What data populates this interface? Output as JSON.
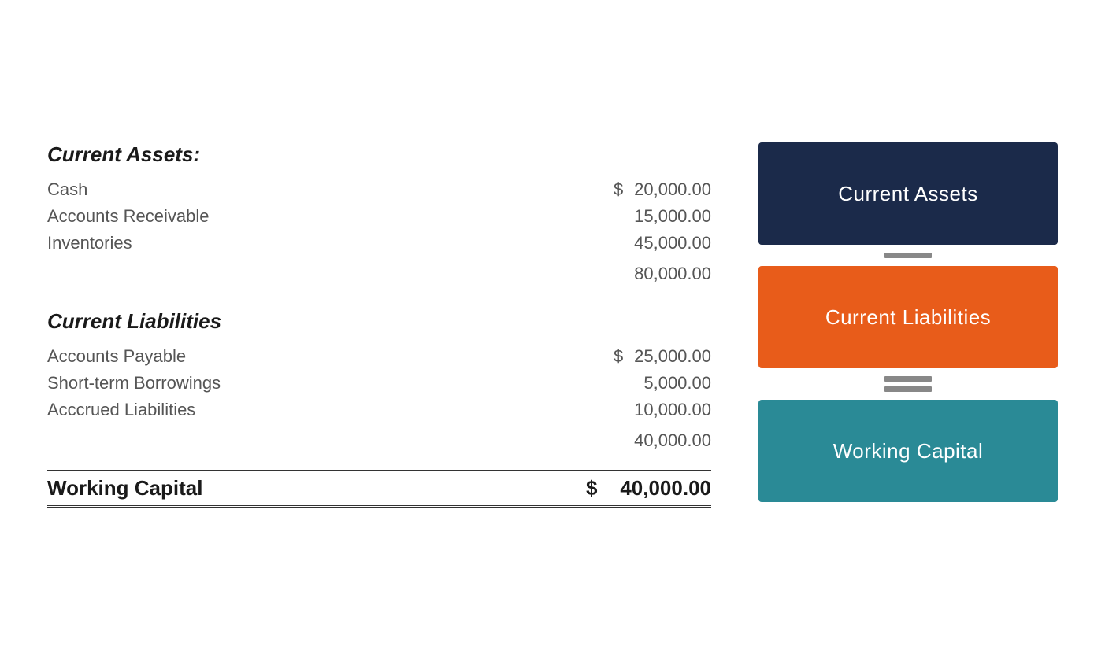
{
  "current_assets": {
    "header": "Current Assets:",
    "items": [
      {
        "label": "Cash",
        "dollar": "$",
        "amount": "20,000.00"
      },
      {
        "label": "Accounts Receivable",
        "dollar": "",
        "amount": "15,000.00"
      },
      {
        "label": "Inventories",
        "dollar": "",
        "amount": "45,000.00"
      }
    ],
    "subtotal": "80,000.00"
  },
  "current_liabilities": {
    "header": "Current Liabilities",
    "items": [
      {
        "label": "Accounts Payable",
        "dollar": "$",
        "amount": "25,000.00"
      },
      {
        "label": "Short-term Borrowings",
        "dollar": "",
        "amount": "5,000.00"
      },
      {
        "label": "Acccrued Liabilities",
        "dollar": "",
        "amount": "10,000.00"
      }
    ],
    "subtotal": "40,000.00"
  },
  "working_capital": {
    "label": "Working Capital",
    "dollar": "$",
    "amount": "40,000.00"
  },
  "right_panel": {
    "card_current_assets": "Current Assets",
    "card_current_liabilities": "Current Liabilities",
    "card_working_capital": "Working Capital"
  }
}
